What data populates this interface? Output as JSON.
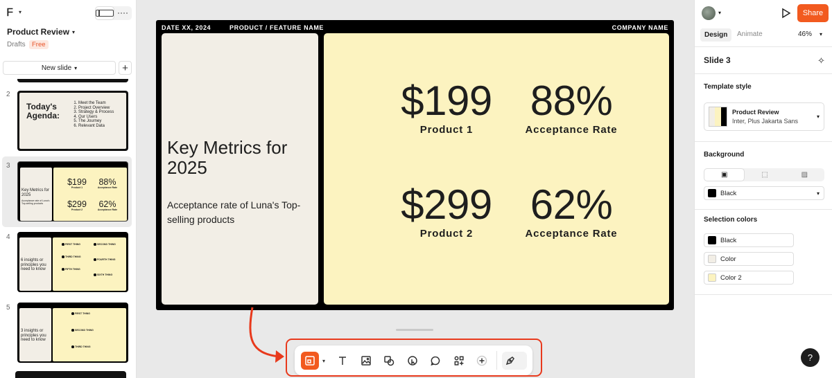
{
  "left_panel": {
    "project_title": "Product Review",
    "drafts_label": "Drafts",
    "plan_badge": "Free",
    "new_slide_label": "New slide",
    "slides": [
      {
        "number": "2",
        "title": "Today's Agenda:",
        "items": [
          "Meet the Team",
          "Project Overview",
          "Strategy & Process",
          "Our Users",
          "The Journey",
          "Relevant Data"
        ]
      },
      {
        "number": "3",
        "title": "Key Metrics for 2025",
        "subtitle": "Acceptance rate of Luna's Top-selling products",
        "metrics": [
          {
            "value": "$199",
            "label": "Product 1"
          },
          {
            "value": "88%",
            "label": "Acceptance Rate"
          },
          {
            "value": "$299",
            "label": "Product 2"
          },
          {
            "value": "62%",
            "label": "Acceptance Rate"
          }
        ]
      },
      {
        "number": "4",
        "title": "6 insights or principles you need to know",
        "items": [
          "FIRST THING",
          "SECOND THING",
          "THIRD THING",
          "FOURTH THING",
          "FIFTH THING",
          "SIXTH THING"
        ]
      },
      {
        "number": "5",
        "title": "3 insights or principles you need to know",
        "items": [
          "FIRST THING",
          "SECOND THING",
          "THIRD THING"
        ]
      }
    ]
  },
  "canvas": {
    "header_date": "DATE XX, 2024",
    "header_product": "PRODUCT / FEATURE NAME",
    "header_company": "COMPANY NAME",
    "title": "Key Metrics for 2025",
    "subtitle": "Acceptance rate of Luna's Top-selling products",
    "metrics": [
      {
        "value": "$199",
        "label": "Product 1"
      },
      {
        "value": "88%",
        "label": "Acceptance Rate"
      },
      {
        "value": "$299",
        "label": "Product 2"
      },
      {
        "value": "62%",
        "label": "Acceptance Rate"
      }
    ]
  },
  "toolbar": {
    "tools": [
      "layout-icon",
      "text-icon",
      "image-icon",
      "shapes-icon",
      "interactive-icon",
      "comment-icon",
      "widgets-icon",
      "add-icon",
      "draw-icon"
    ],
    "accent_color": "#f25a1f",
    "highlight_color": "#e8391c"
  },
  "right_panel": {
    "share_label": "Share",
    "tab_design": "Design",
    "tab_animate": "Animate",
    "zoom": "46%",
    "slide_label": "Slide 3",
    "template_style_title": "Template style",
    "template_name": "Product Review",
    "template_fonts": "Inter, Plus Jakarta Sans",
    "background_title": "Background",
    "background_value": "Black",
    "selection_colors_title": "Selection colors",
    "selection_colors": [
      {
        "name": "Black",
        "hex": "#000000"
      },
      {
        "name": "Color",
        "hex": "#f2eee6"
      },
      {
        "name": "Color 2",
        "hex": "#fcf3c0"
      }
    ]
  },
  "help_label": "?"
}
